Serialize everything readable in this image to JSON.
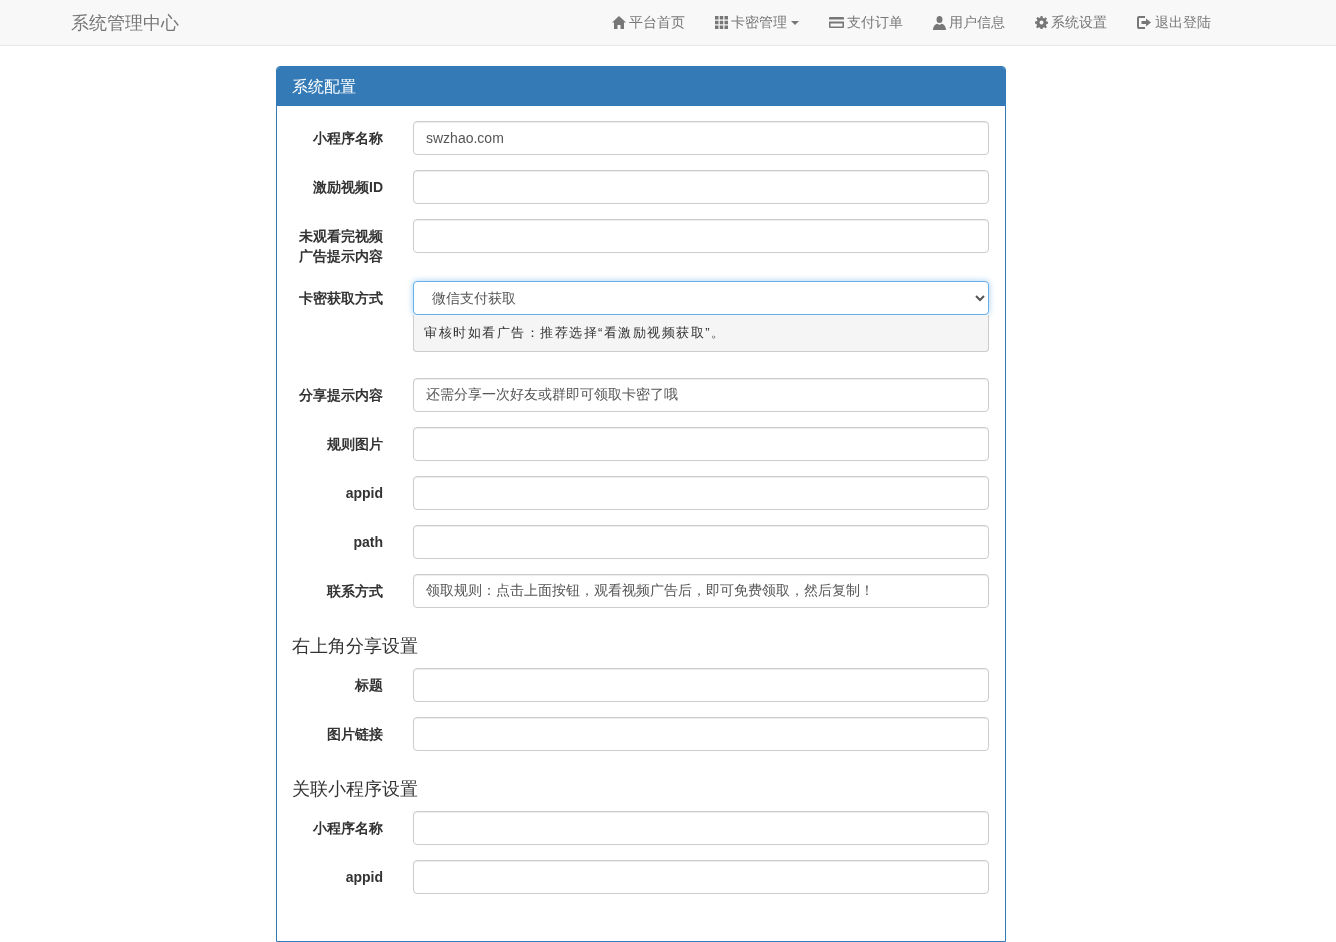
{
  "navbar": {
    "brand": "系统管理中心",
    "items": [
      {
        "label": "平台首页",
        "kind": "home",
        "dropdown": false
      },
      {
        "label": "卡密管理",
        "kind": "grid",
        "dropdown": true
      },
      {
        "label": "支付订单",
        "kind": "card",
        "dropdown": false
      },
      {
        "label": "用户信息",
        "kind": "user",
        "dropdown": false
      },
      {
        "label": "系统设置",
        "kind": "gear",
        "dropdown": false
      },
      {
        "label": "退出登陆",
        "kind": "logout",
        "dropdown": false
      }
    ]
  },
  "panel": {
    "title": "系统配置",
    "sections": [
      {
        "fields": [
          {
            "kind": "input",
            "label": "小程序名称",
            "value": "swzhao.com"
          },
          {
            "kind": "input",
            "label": "激励视频ID"
          },
          {
            "kind": "input",
            "label": "未观看完视频广告提示内容"
          },
          {
            "kind": "select",
            "label": "卡密获取方式",
            "value": "微信支付获取",
            "help": "审核时如看广告：推荐选择“看激励视频获取”。"
          },
          {
            "kind": "input",
            "label": "分享提示内容",
            "value": "还需分享一次好友或群即可领取卡密了哦"
          },
          {
            "kind": "input",
            "label": "规则图片"
          },
          {
            "kind": "input",
            "label": "appid"
          },
          {
            "kind": "input",
            "label": "path"
          },
          {
            "kind": "input",
            "label": "联系方式",
            "value": "领取规则：点击上面按钮，观看视频广告后，即可免费领取，然后复制！"
          }
        ]
      },
      {
        "heading": "右上角分享设置",
        "fields": [
          {
            "kind": "input",
            "label": "标题"
          },
          {
            "kind": "input",
            "label": "图片链接"
          }
        ]
      },
      {
        "heading": "关联小程序设置",
        "fields": [
          {
            "kind": "input",
            "label": "小程序名称"
          },
          {
            "kind": "input",
            "label": "appid"
          }
        ]
      }
    ]
  }
}
